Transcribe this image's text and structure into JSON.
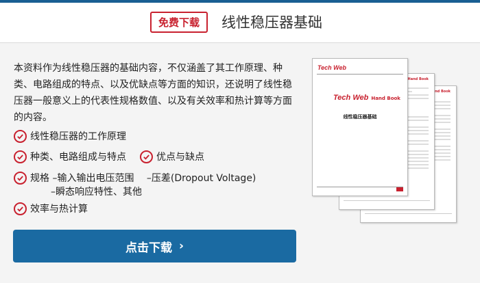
{
  "header": {
    "badge": "免费下载",
    "title": "线性稳压器基础"
  },
  "description": "本资料作为线性稳压器的基础内容，不仅涵盖了其工作原理、种类、电路组成的特点、以及优缺点等方面的知识，还说明了线性稳压器一般意义上的代表性规格数值、以及有关效率和热计算等方面的内容。",
  "features": {
    "f1": "线性稳压器的工作原理",
    "f2": "种类、电路组成与特点",
    "f3": "优点与缺点",
    "f4_line1": "规格 –输入输出电压范围　 –压差(Dropout Voltage)",
    "f4_line2": "–瞬态响应特性、其他",
    "f5": "效率与热计算"
  },
  "cta": {
    "label": "点击下载",
    "arrow": "›"
  },
  "illustration": {
    "brand": "Tech Web",
    "handbook": "Hand Book",
    "doc_title": "线性稳压器基础"
  },
  "colors": {
    "accent_red": "#c8202e",
    "button_blue": "#1a6aa2",
    "top_bar": "#1a5f93"
  }
}
